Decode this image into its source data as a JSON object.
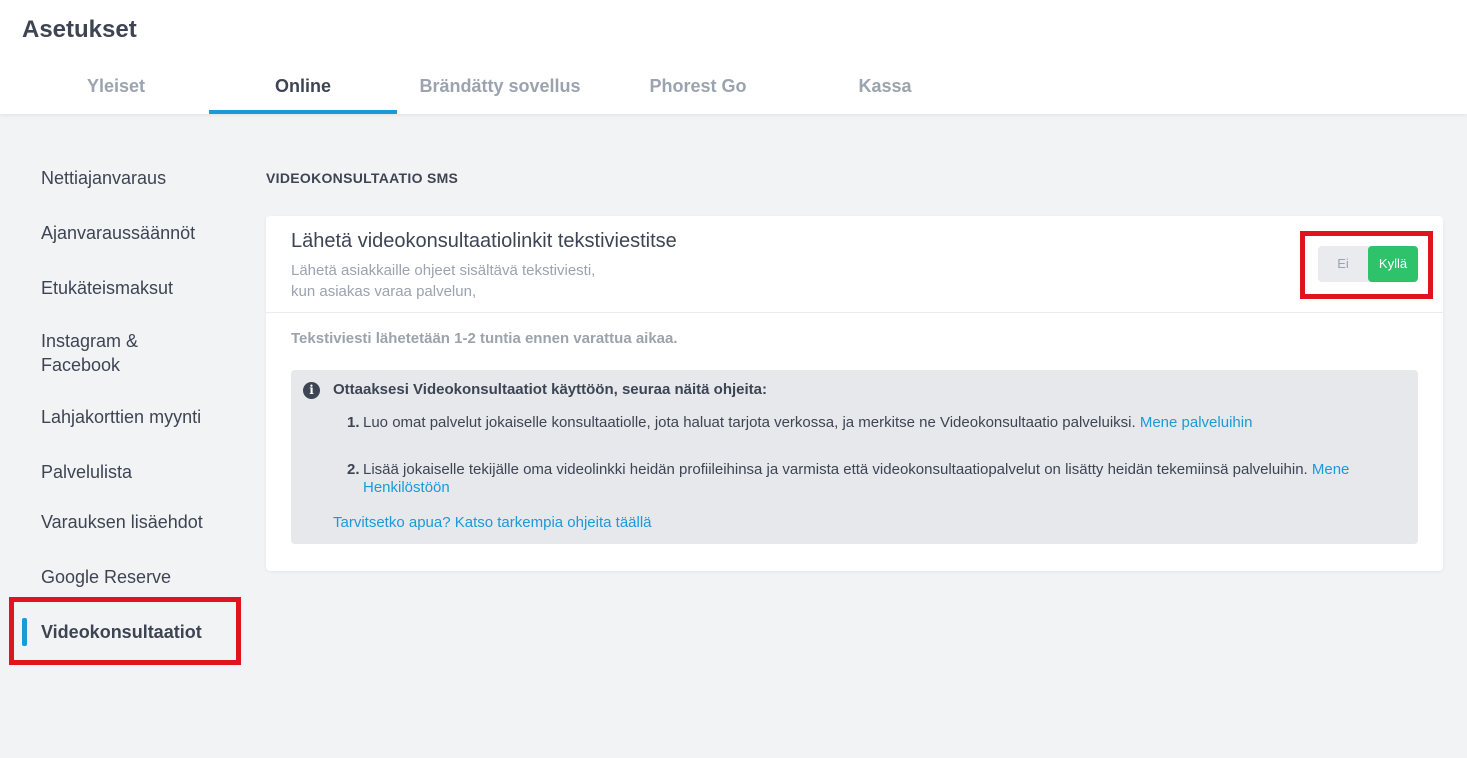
{
  "header": {
    "title": "Asetukset",
    "tabs": [
      {
        "label": "Yleiset"
      },
      {
        "label": "Online"
      },
      {
        "label": "Brändätty sovellus"
      },
      {
        "label": "Phorest Go"
      },
      {
        "label": "Kassa"
      }
    ],
    "active_tab": "Online"
  },
  "sidebar": {
    "items": [
      {
        "label": "Nettiajanvaraus"
      },
      {
        "label": "Ajanvaraussäännöt"
      },
      {
        "label": "Etukäteismaksut"
      },
      {
        "label": "Instagram & Facebook"
      },
      {
        "label": "Lahjakorttien myynti"
      },
      {
        "label": "Palvelulista"
      },
      {
        "label": "Varauksen lisäehdot"
      },
      {
        "label": "Google Reserve"
      },
      {
        "label": "Videokonsultaatiot"
      }
    ],
    "active_item": "Videokonsultaatiot"
  },
  "main": {
    "section_title": "VIDEOKONSULTAATIO SMS",
    "card": {
      "title": "Lähetä videokonsultaatiolinkit tekstiviestitse",
      "subtitle_line1": "Lähetä asiakkaille ohjeet sisältävä tekstiviesti,",
      "subtitle_line2": "kun asiakas varaa palvelun,",
      "toggle": {
        "off_label": "Ei",
        "on_label": "Kyllä",
        "value": "Kyllä"
      },
      "note": "Tekstiviesti lähetetään 1-2 tuntia ennen varattua aikaa.",
      "info": {
        "icon": "info-icon",
        "title": "Ottaaksesi Videokonsultaatiot käyttöön, seuraa näitä ohjeita:",
        "steps": [
          {
            "num": "1.",
            "text": "Luo omat palvelut jokaiselle konsultaatiolle, jota haluat tarjota verkossa, ja merkitse ne Videokonsultaatio palveluiksi.",
            "link": "Mene palveluihin"
          },
          {
            "num": "2.",
            "text": "Lisää jokaiselle tekijälle oma videolinkki heidän profiileihinsa ja varmista että videokonsultaatiopalvelut on lisätty heidän tekemiinsä palveluihin.",
            "link": "Mene Henkilöstöön"
          }
        ],
        "help_link": "Tarvitsetko apua? Katso tarkempia ohjeita täällä"
      }
    }
  },
  "colors": {
    "accent": "#1a9ad6",
    "toggle_on": "#2ec36a",
    "highlight": "#e0141e",
    "background": "#f2f3f5"
  }
}
